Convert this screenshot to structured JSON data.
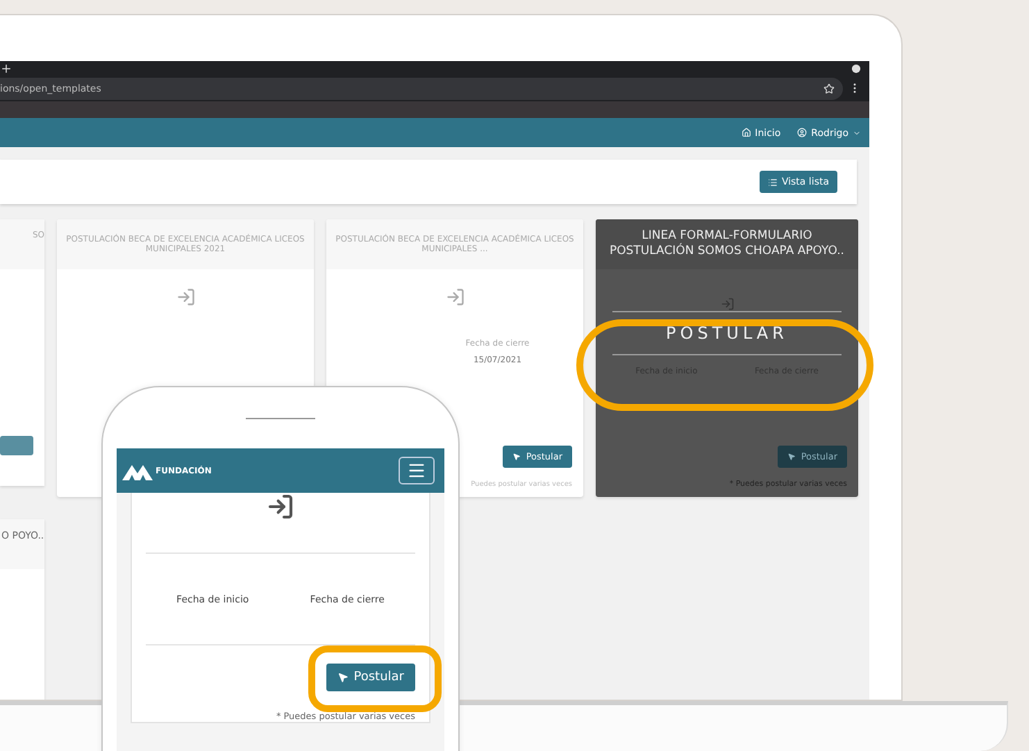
{
  "browser": {
    "url": "ions/open_templates"
  },
  "nav": {
    "items": [
      {
        "kind": "home",
        "label": "Inicio"
      },
      {
        "kind": "user",
        "label": "Rodrigo"
      }
    ]
  },
  "toolbar": {
    "view_button": "Vista lista"
  },
  "cards": [
    {
      "kind": "partial",
      "title": "SO"
    },
    {
      "kind": "card",
      "title": "POSTULACIÓN BECA DE EXCELENCIA ACADÉMICA LICEOS MUNICIPALES 2021"
    },
    {
      "kind": "card",
      "title": "POSTULACIÓN BECA DE EXCELENCIA ACADÉMICA LICEOS MUNICIPALES ...",
      "end_label": "Fecha de cierre",
      "end_date": "15/07/2021",
      "button": "Postular",
      "note": "Puedes postular varias veces"
    },
    {
      "kind": "highlighted",
      "title": "LINEA FORMAL-FORMULARIO POSTULACIÓN SOMOS CHOAPA APOYO..",
      "overlay": "POSTULAR",
      "start_label": "Fecha de inicio",
      "end_label": "Fecha de cierre",
      "button": "Postular",
      "note": "* Puedes postular varias veces"
    }
  ],
  "second_row": [
    {
      "kind": "partial",
      "title": "O POYO.."
    }
  ],
  "phone": {
    "brand": "FUNDACIÓN",
    "start_label": "Fecha de inicio",
    "end_label": "Fecha de cierre",
    "button": "Postular",
    "note": "* Puedes postular varias veces"
  }
}
